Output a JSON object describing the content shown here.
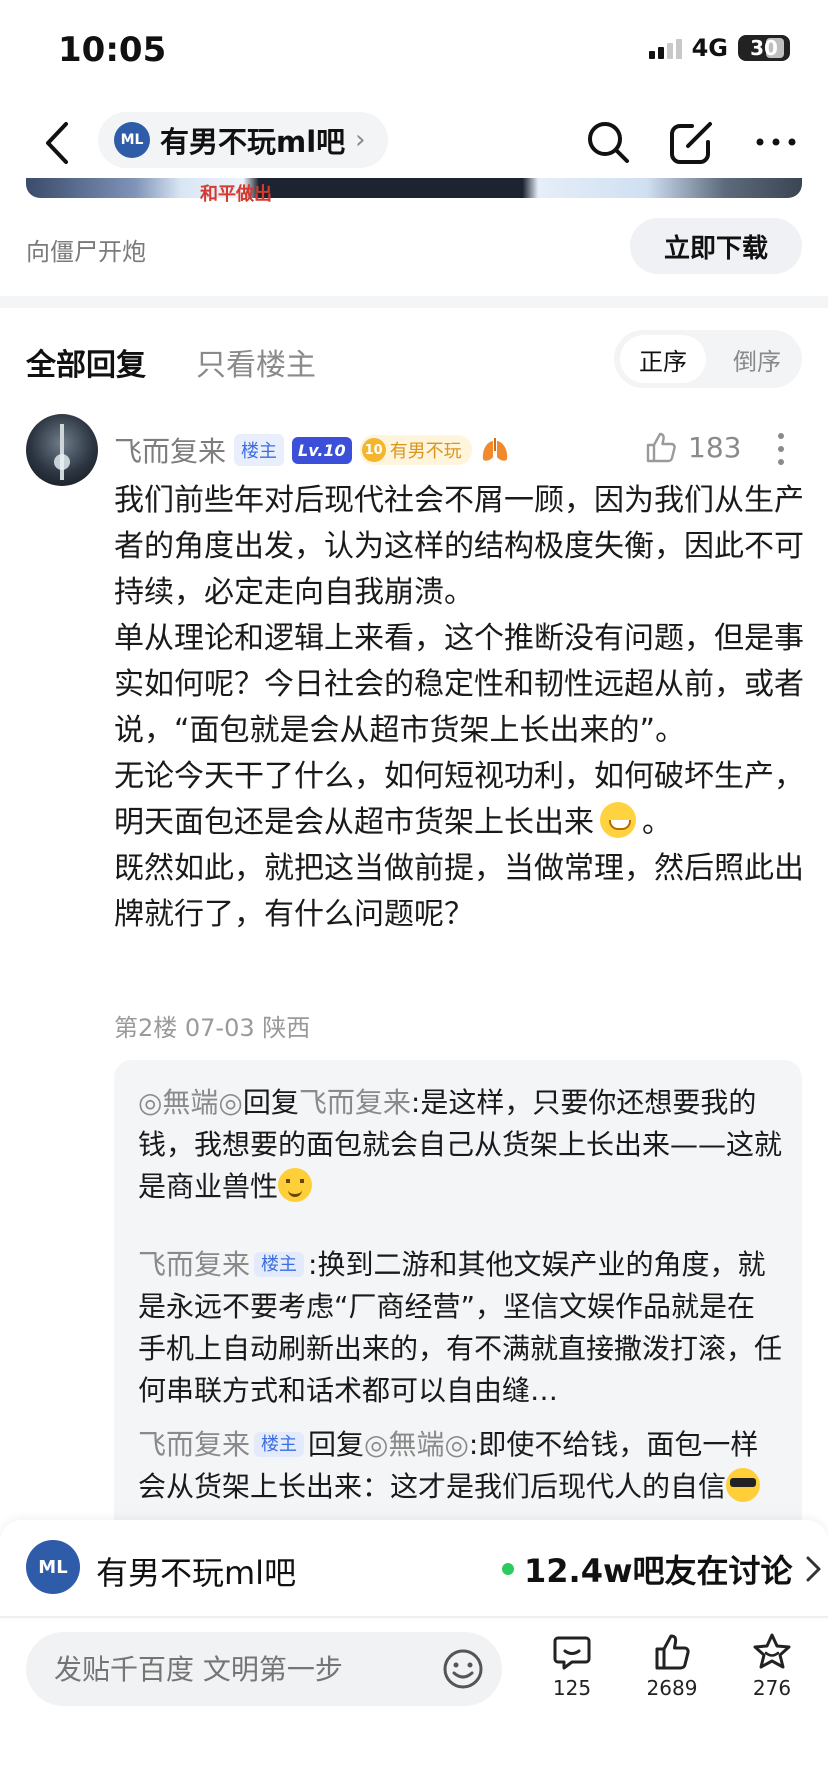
{
  "status_bar": {
    "time": "10:05",
    "network": "4G",
    "battery": "30"
  },
  "nav": {
    "forum_name": "有男不玩ml吧"
  },
  "banner": {
    "text": "和平做出"
  },
  "ad": {
    "text": "向僵尸开炮",
    "button": "立即下载"
  },
  "tabs": {
    "all": "全部回复",
    "op_only": "只看楼主",
    "sort_asc": "正序",
    "sort_desc": "倒序"
  },
  "post": {
    "author": "飞而复来",
    "badge_op": "楼主",
    "badge_level": "Lv.10",
    "badge_medal": "10",
    "badge_forum": "有男不玩",
    "likes": "183",
    "paragraphs": [
      "我们前些年对后现代社会不屑一顾，因为我们从生产者的角度出发，认为这样的结构极度失衡，因此不可持续，必定走向自我崩溃。",
      "单从理论和逻辑上来看，这个推断没有问题，但是事实如何呢？今日社会的稳定性和韧性远超从前，或者说，“面包就是会从超市货架上长出来的”。",
      "无论今天干了什么，如何短视功利，如何破坏生产，明天面包还是会从超市货架上长出来",
      "。",
      "既然如此，就把这当做前提，当做常理，然后照此出牌就行了，有什么问题呢？"
    ],
    "meta": "第2楼 07-03 陕西"
  },
  "replies": [
    {
      "name": "◎無端◎",
      "reply_word": "回复",
      "to": "飞而复来",
      "text": ":是这样，只要你还想要我的钱，我想要的面包就会自己从货架上长出来——这就是商业兽性"
    },
    {
      "name": "飞而复来",
      "badge": "楼主",
      "text": ":换到二游和其他文娱产业的角度，就是永远不要考虑“厂商经营”，坚信文娱作品就是在手机上自动刷新出来的，有不满就直接撒泼打滚，任何串联方式和话术都可以自由缝…"
    },
    {
      "name": "飞而复来",
      "badge": "楼主",
      "reply_word": "回复",
      "to": "◎無端◎",
      "text": ":即使不给钱，面包一样会从货架上长出来：这才是我们后现代人的自信",
      "tail": "。"
    }
  ],
  "forum_bar": {
    "name": "有男不玩ml吧",
    "discussing": "12.4w吧友在讨论"
  },
  "bottom": {
    "placeholder": "发贴千百度 文明第一步",
    "comments": "125",
    "likes": "2689",
    "favorites": "276"
  },
  "colors": {
    "accent_blue": "#3b6fe0",
    "online_green": "#2ccb5f",
    "forum_logo": "#2f5ca8"
  }
}
